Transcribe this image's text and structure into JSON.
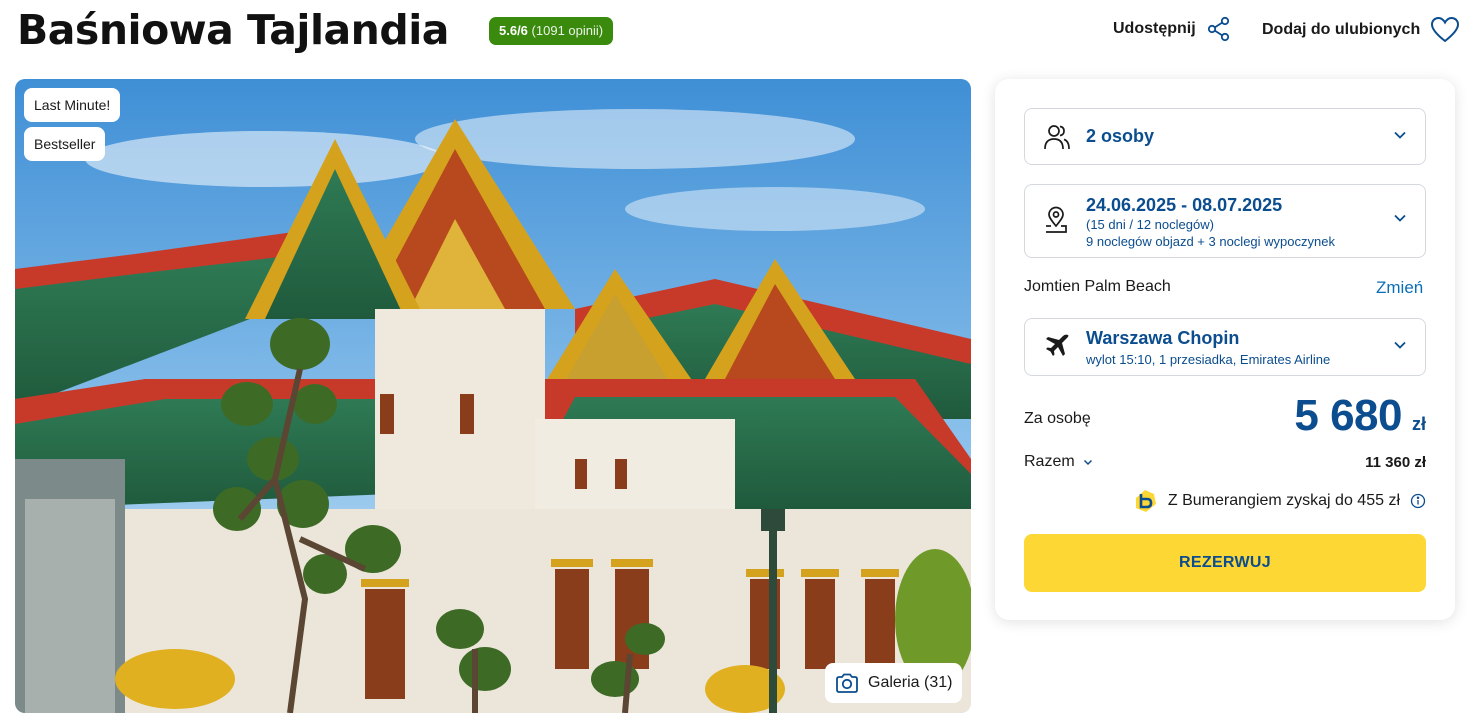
{
  "header": {
    "title": "Baśniowa Tajlandia",
    "rating_score": "5.6/6",
    "rating_count": "(1091 opinii)",
    "share_label": "Udostępnij",
    "favorite_label": "Dodaj do ulubionych"
  },
  "hero": {
    "tags": [
      "Last Minute!",
      "Bestseller"
    ],
    "gallery_label": "Galeria (31)"
  },
  "booking": {
    "persons": "2 osoby",
    "dates": "24.06.2025 - 08.07.2025",
    "duration": "(15 dni / 12 noclegów)",
    "itinerary": "9 noclegów objazd + 3 noclegi wypoczynek",
    "hotel": "Jomtien Palm Beach",
    "change_label": "Zmień",
    "airport": "Warszawa Chopin",
    "flight_details": "wylot 15:10, 1 przesiadka, Emirates Airline",
    "per_person_label": "Za osobę",
    "price": "5 680",
    "currency": "zł",
    "total_label": "Razem",
    "total_value": "11 360 zł",
    "bumerang_text": "Z Bumerangiem zyskaj do 455 zł",
    "reserve_label": "REZERWUJ"
  },
  "colors": {
    "brand_blue": "#0b4d8e",
    "rating_green": "#3a8a0e",
    "cta_yellow": "#fdd835"
  }
}
